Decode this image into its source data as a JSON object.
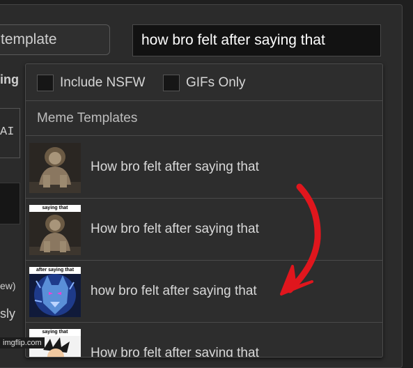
{
  "header": {
    "template_button_label": "template",
    "search_value": "how bro felt after saying that"
  },
  "left_fragments": {
    "ing": "ing",
    "ai": "AI",
    "ew": "ew)",
    "sly": "sly"
  },
  "dropdown": {
    "filters": {
      "nsfw_label": "Include NSFW",
      "gifs_label": "GIFs Only"
    },
    "section_title": "Meme Templates",
    "results": [
      {
        "label": "How bro felt after saying that",
        "thumb_caption": ""
      },
      {
        "label": "How bro felt after saying that",
        "thumb_caption": "saying that"
      },
      {
        "label": "how bro felt after saying that",
        "thumb_caption": "after saying that"
      },
      {
        "label": "How bro felt after saying that",
        "thumb_caption": "saying that"
      }
    ]
  },
  "watermark": "imgflip.com",
  "colors": {
    "arrow": "#e0161d",
    "panel_bg": "#2b2b2b",
    "dropdown_bg": "#2d2d2d"
  }
}
